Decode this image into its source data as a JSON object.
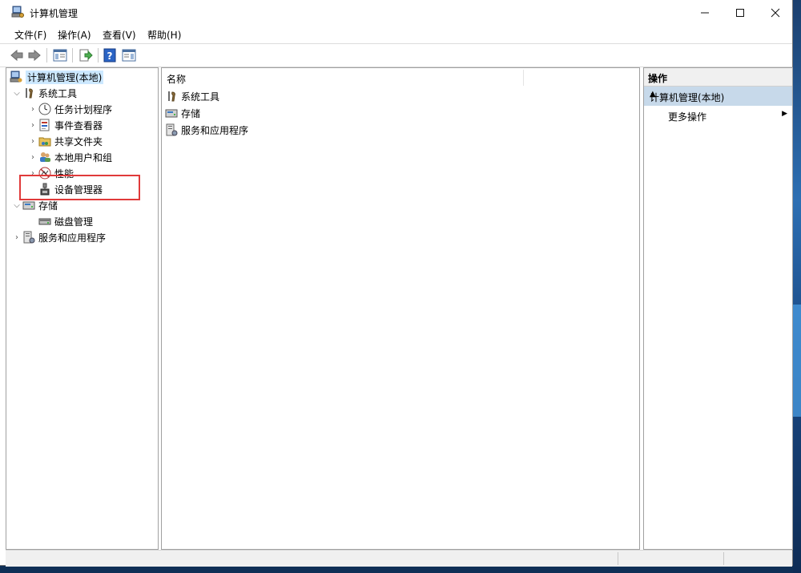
{
  "window": {
    "title": "计算机管理"
  },
  "menu": [
    "文件(F)",
    "操作(A)",
    "查看(V)",
    "帮助(H)"
  ],
  "tree": {
    "root": "计算机管理(本地)",
    "system_tools": "系统工具",
    "task_scheduler": "任务计划程序",
    "event_viewer": "事件查看器",
    "shared_folders": "共享文件夹",
    "local_users": "本地用户和组",
    "performance": "性能",
    "device_manager": "设备管理器",
    "storage": "存储",
    "disk_management": "磁盘管理",
    "services_apps": "服务和应用程序"
  },
  "list": {
    "column_name": "名称",
    "items": [
      "系统工具",
      "存储",
      "服务和应用程序"
    ]
  },
  "actions": {
    "header": "操作",
    "group": "计算机管理(本地)",
    "more": "更多操作"
  }
}
